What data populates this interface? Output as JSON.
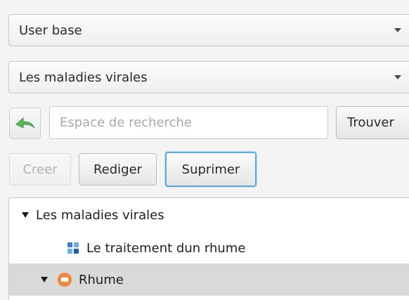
{
  "combos": {
    "base": {
      "label": "User base"
    },
    "category": {
      "label": "Les maladies virales"
    }
  },
  "search": {
    "placeholder": "Espace de recherche",
    "value": "",
    "find_label": "Trouver"
  },
  "toolbar": {
    "create_label": "Creer",
    "edit_label": "Rediger",
    "delete_label": "Suprimer"
  },
  "tree": {
    "items": [
      {
        "label": "Les maladies virales",
        "expanded": true,
        "icon": "none"
      },
      {
        "label": "Le traitement dun rhume",
        "icon": "document-grid-icon"
      },
      {
        "label": "Rhume",
        "expanded": true,
        "selected": true,
        "icon": "disease-icon"
      }
    ]
  },
  "colors": {
    "focus_border": "#5fa9dc",
    "selection_bg": "#d9d9d9",
    "back_arrow": "#5cb85c",
    "disease_icon": "#f0893d"
  }
}
